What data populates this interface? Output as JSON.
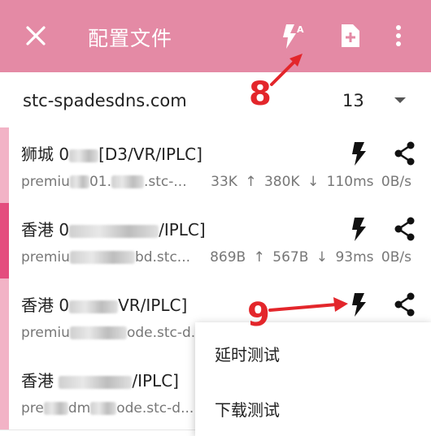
{
  "appbar": {
    "title": "配置文件",
    "close_icon": "close-icon",
    "flash_auto_icon": "flash-auto-icon",
    "new_file_icon": "new-file-icon",
    "more_icon": "more-vertical-icon",
    "background": "#e48aa5"
  },
  "group": {
    "name": "stc-spadesdns.com",
    "count": "13"
  },
  "items": [
    {
      "name_prefix": "狮城 0",
      "name_suffix": "[D3/VR/IPLC]",
      "host_prefix": "premiu",
      "host_suffix": "01.",
      "host_tail": ".stc-...",
      "upload": "33K ↑",
      "download": "380K ↓",
      "latency": "110ms",
      "speed": "0B/s",
      "bar_color": "#f2b3c6"
    },
    {
      "name_prefix": "香港 0",
      "name_suffix": "/IPLC]",
      "host_prefix": "premiu",
      "host_suffix": "",
      "host_tail": "bd.stc...",
      "upload": "869B ↑",
      "download": "567B ↓",
      "latency": "93ms",
      "speed": "0B/s",
      "bar_color": "#e44d7e"
    },
    {
      "name_prefix": "香港 0",
      "name_suffix": "VR/IPLC]",
      "host_prefix": "premiu",
      "host_suffix": "",
      "host_tail": "ode.stc-d...",
      "bar_color": "#f2b3c6"
    },
    {
      "name_prefix": "香港 ",
      "name_suffix": "/IPLC]",
      "host_prefix": "pre",
      "host_suffix": "dm",
      "host_tail": "ode.stc-d...",
      "bar_color": "#f2b3c6"
    }
  ],
  "menu": {
    "latency_test": "延时测试",
    "download_test": "下载测试"
  },
  "annotations": {
    "label_8": "8",
    "label_9": "9",
    "color": "#e3262b"
  }
}
